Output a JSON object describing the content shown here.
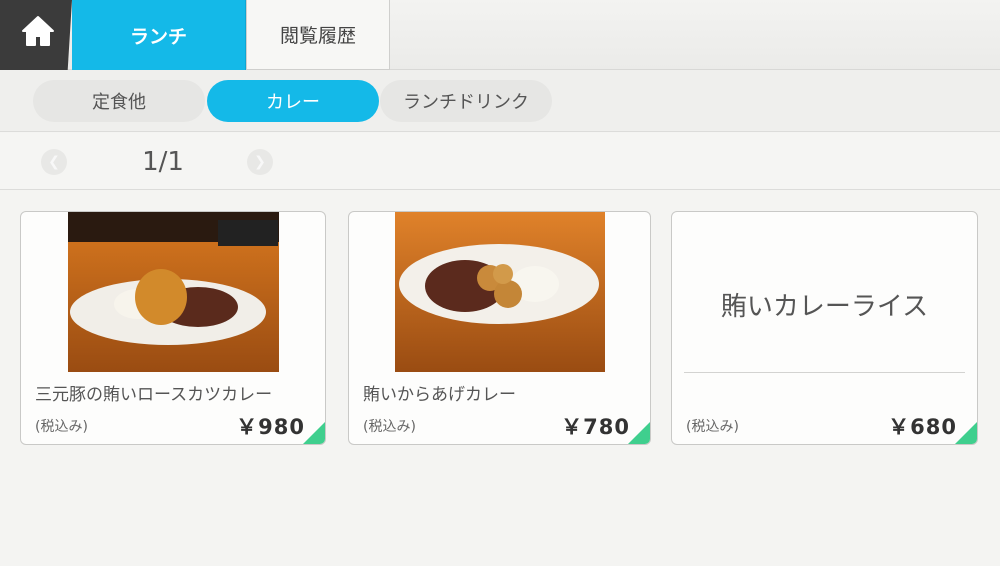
{
  "tabs": {
    "home_icon": "home-icon",
    "lunch_label": "ランチ",
    "history_label": "閲覧履歴"
  },
  "categories": {
    "items": [
      "定食他",
      "カレー",
      "ランチドリンク"
    ],
    "selected": "カレー"
  },
  "pager": {
    "label": "1/1"
  },
  "menu_items": [
    {
      "name": "三元豚の賄いロースカツカレー",
      "tax_label": "(税込み)",
      "price": "￥980",
      "photo": "katsu-curry-photo"
    },
    {
      "name": "賄いからあげカレー",
      "tax_label": "(税込み)",
      "price": "￥780",
      "photo": "karaage-curry-photo"
    },
    {
      "name": "賄いカレーライス",
      "tax_label": "(税込み)",
      "price": "￥680"
    }
  ],
  "colors": {
    "accent": "#14b9e8",
    "home_bg": "#3b3b3b",
    "corner_badge": "#3fcf8e"
  }
}
